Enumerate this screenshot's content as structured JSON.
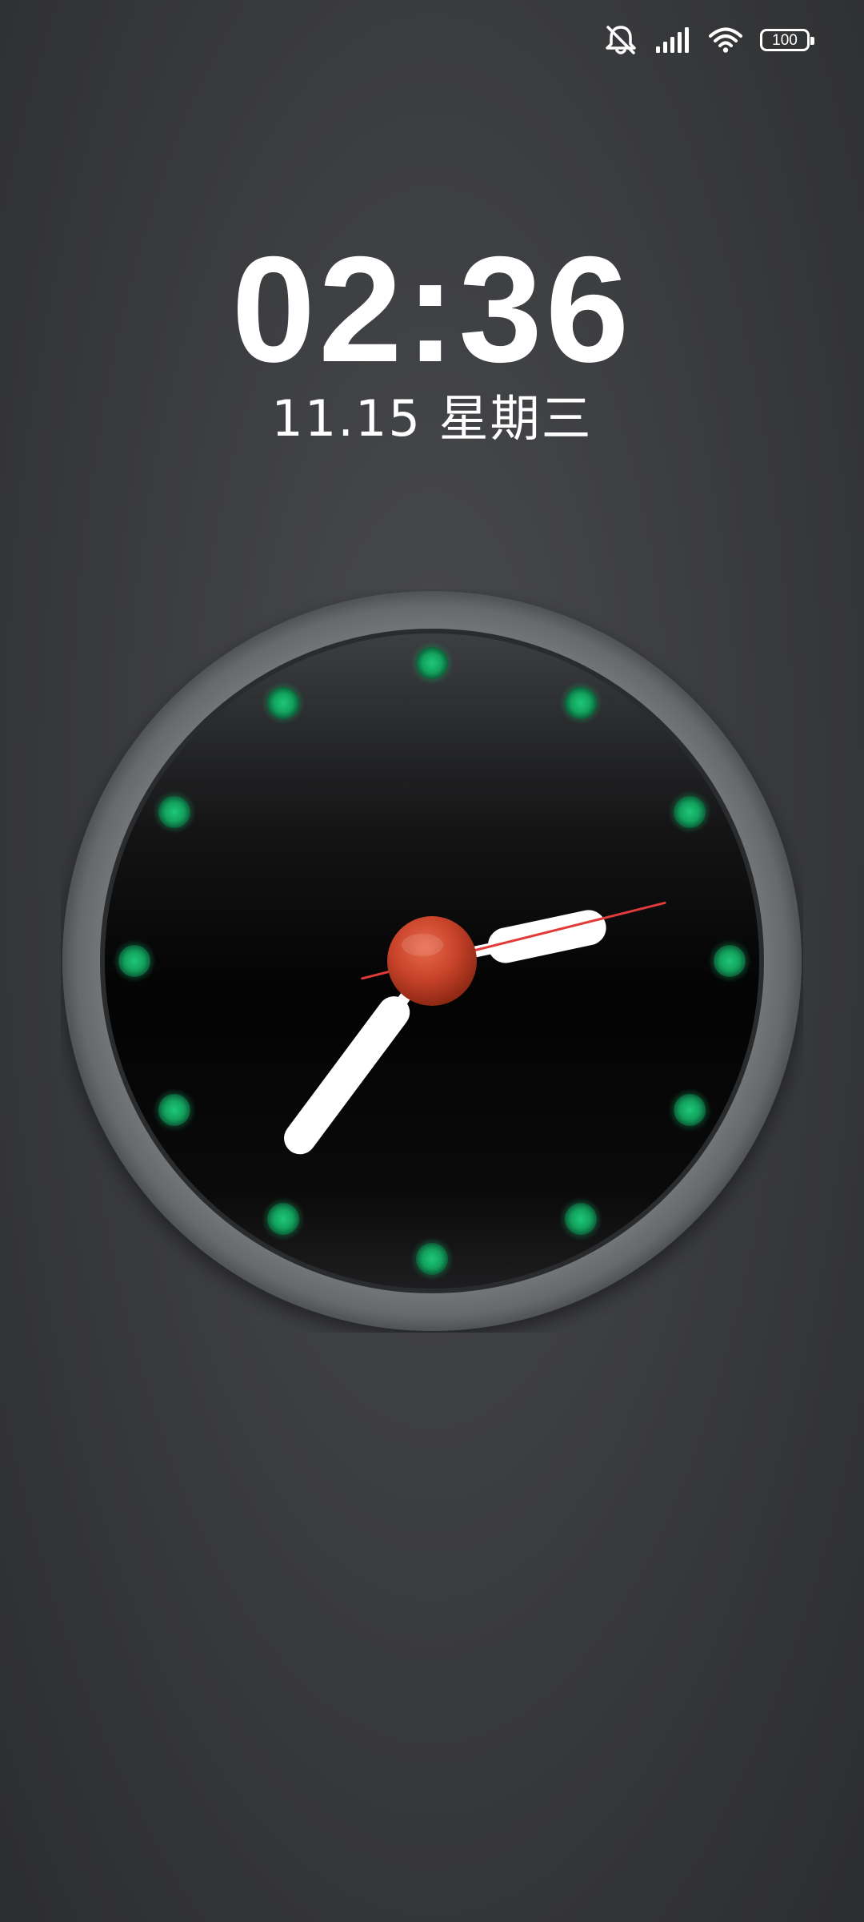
{
  "status_bar": {
    "icons": [
      "bell-muted-icon",
      "signal-icon",
      "wifi-icon",
      "battery-icon"
    ],
    "battery_level": "100"
  },
  "lock_screen": {
    "time": "02:36",
    "date": "11.15 星期三"
  },
  "analog_clock": {
    "hour": 2,
    "minute": 36,
    "second": 7,
    "colors": {
      "bezel": "#6b6e71",
      "face": "#050505",
      "markers": "#12a25e",
      "hands": "#ffffff",
      "second_hand": "#e03a3a",
      "center_cap": "#c8432a"
    }
  }
}
